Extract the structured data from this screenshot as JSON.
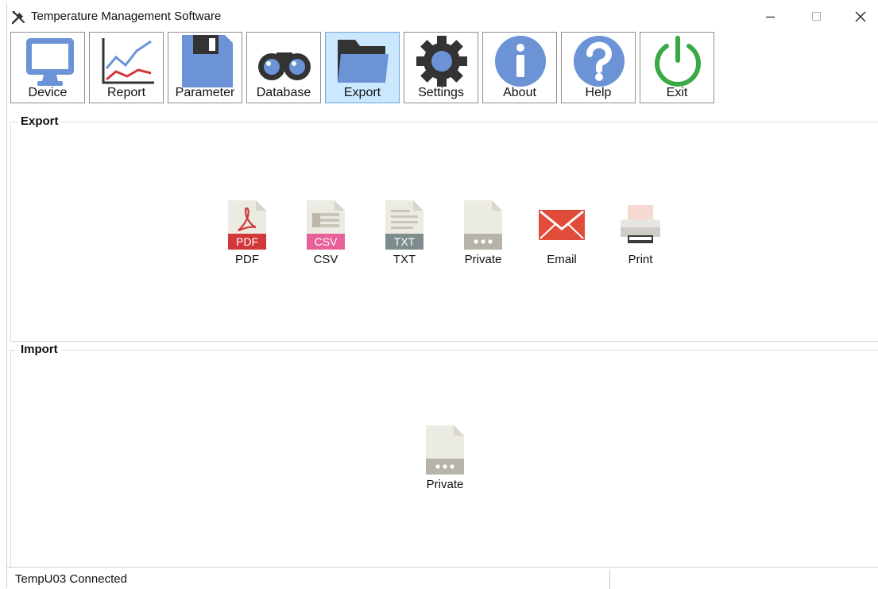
{
  "window": {
    "title": "Temperature Management Software",
    "icon": "tools-icon"
  },
  "toolbar": {
    "items": [
      {
        "label": "Device",
        "icon": "monitor-icon"
      },
      {
        "label": "Report",
        "icon": "line-chart-icon"
      },
      {
        "label": "Parameter",
        "icon": "floppy-disk-icon"
      },
      {
        "label": "Database",
        "icon": "binoculars-icon"
      },
      {
        "label": "Export",
        "icon": "folder-icon",
        "active": true
      },
      {
        "label": "Settings",
        "icon": "gear-icon"
      },
      {
        "label": "About",
        "icon": "info-icon"
      },
      {
        "label": "Help",
        "icon": "question-icon"
      },
      {
        "label": "Exit",
        "icon": "power-icon"
      }
    ]
  },
  "export": {
    "title": "Export",
    "items": [
      {
        "label": "PDF",
        "icon": "pdf-file-icon",
        "tag": "PDF"
      },
      {
        "label": "CSV",
        "icon": "csv-file-icon",
        "tag": "CSV"
      },
      {
        "label": "TXT",
        "icon": "txt-file-icon",
        "tag": "TXT"
      },
      {
        "label": "Private",
        "icon": "private-file-icon"
      },
      {
        "label": "Email",
        "icon": "email-icon"
      },
      {
        "label": "Print",
        "icon": "printer-icon"
      }
    ]
  },
  "import": {
    "title": "Import",
    "items": [
      {
        "label": "Private",
        "icon": "private-file-icon"
      }
    ]
  },
  "status": {
    "text": "TempU03 Connected"
  },
  "colors": {
    "active_tool_bg": "#cce8ff",
    "icon_blue": "#6b93d6",
    "pdf_red": "#d2373a",
    "csv_pink": "#e8609a",
    "txt_gray": "#7f8c8d",
    "private_gray": "#b8b3a8",
    "email_red": "#e04b3a",
    "exit_green": "#3aa845"
  }
}
